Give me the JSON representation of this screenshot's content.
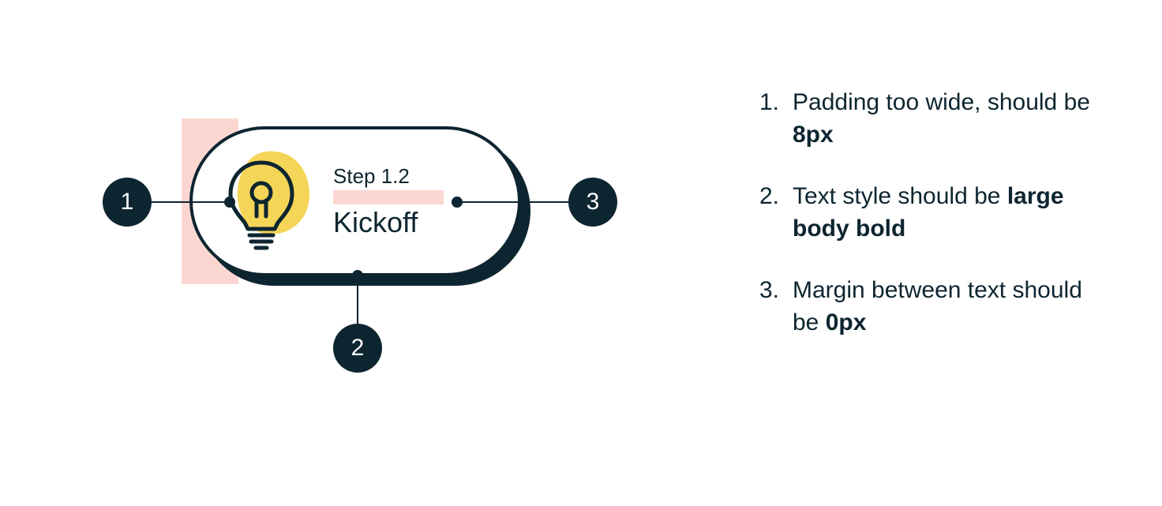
{
  "pill": {
    "step_label": "Step 1.2",
    "title": "Kickoff"
  },
  "callouts": {
    "b1": "1",
    "b2": "2",
    "b3": "3"
  },
  "annotations": [
    {
      "num": "1.",
      "text_pre": "Padding too wide, should be ",
      "bold": "8px",
      "text_post": ""
    },
    {
      "num": "2.",
      "text_pre": "Text style should be ",
      "bold": "large body bold",
      "text_post": ""
    },
    {
      "num": "3.",
      "text_pre": "Margin between text should be ",
      "bold": "0px",
      "text_post": ""
    }
  ],
  "colors": {
    "ink": "#0d2530",
    "highlight": "#fcd7d2",
    "bulb_fill": "#f5d557"
  }
}
